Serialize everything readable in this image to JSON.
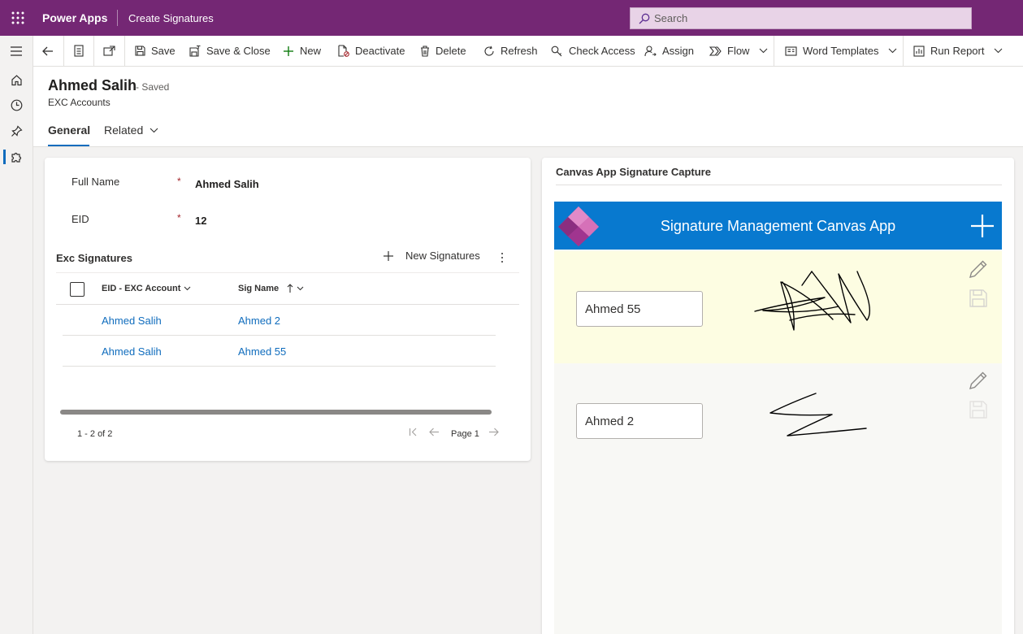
{
  "topbar": {
    "app_name": "Power Apps",
    "breadcrumb": "Create Signatures",
    "search_placeholder": "Search"
  },
  "commands": [
    {
      "label": "Save",
      "icon": "save-icon"
    },
    {
      "label": "Save & Close",
      "icon": "save-close-icon"
    },
    {
      "label": "New",
      "icon": "plus-icon"
    },
    {
      "label": "Deactivate",
      "icon": "deactivate-icon"
    },
    {
      "label": "Delete",
      "icon": "delete-icon"
    },
    {
      "label": "Refresh",
      "icon": "refresh-icon"
    },
    {
      "label": "Check Access",
      "icon": "check-access-icon"
    },
    {
      "label": "Assign",
      "icon": "assign-icon"
    },
    {
      "label": "Flow",
      "icon": "flow-icon"
    },
    {
      "label": "Word Templates",
      "icon": "word-templates-icon"
    },
    {
      "label": "Run Report",
      "icon": "report-icon"
    }
  ],
  "record": {
    "title": "Ahmed Salih",
    "status": "- Saved",
    "entity": "EXC Accounts",
    "tabs": [
      "General",
      "Related"
    ]
  },
  "form": {
    "fields": [
      {
        "label": "Full Name",
        "required_mark": "*",
        "value": "Ahmed Salih"
      },
      {
        "label": "EID",
        "required_mark": "*",
        "value": "12"
      }
    ],
    "subgrid": {
      "title": "Exc Signatures",
      "new_label": "New Signatures",
      "columns": [
        "EID - EXC Account",
        "Sig Name"
      ],
      "rows": [
        [
          "Ahmed Salih",
          "Ahmed 2"
        ],
        [
          "Ahmed Salih",
          "Ahmed 55"
        ]
      ],
      "count": "1 - 2 of 2",
      "page": "Page 1"
    }
  },
  "canvas": {
    "section_title": "Canvas App Signature Capture",
    "app_title": "Signature Management Canvas App",
    "items": [
      {
        "name": "Ahmed 55",
        "highlighted": true
      },
      {
        "name": "Ahmed 2",
        "highlighted": false
      }
    ]
  },
  "colors": {
    "topbar": "#742774",
    "accent": "#0f6cbd",
    "app_bar": "#0879cf",
    "selected_item": "#fdfde2",
    "required": "#a4262c"
  }
}
